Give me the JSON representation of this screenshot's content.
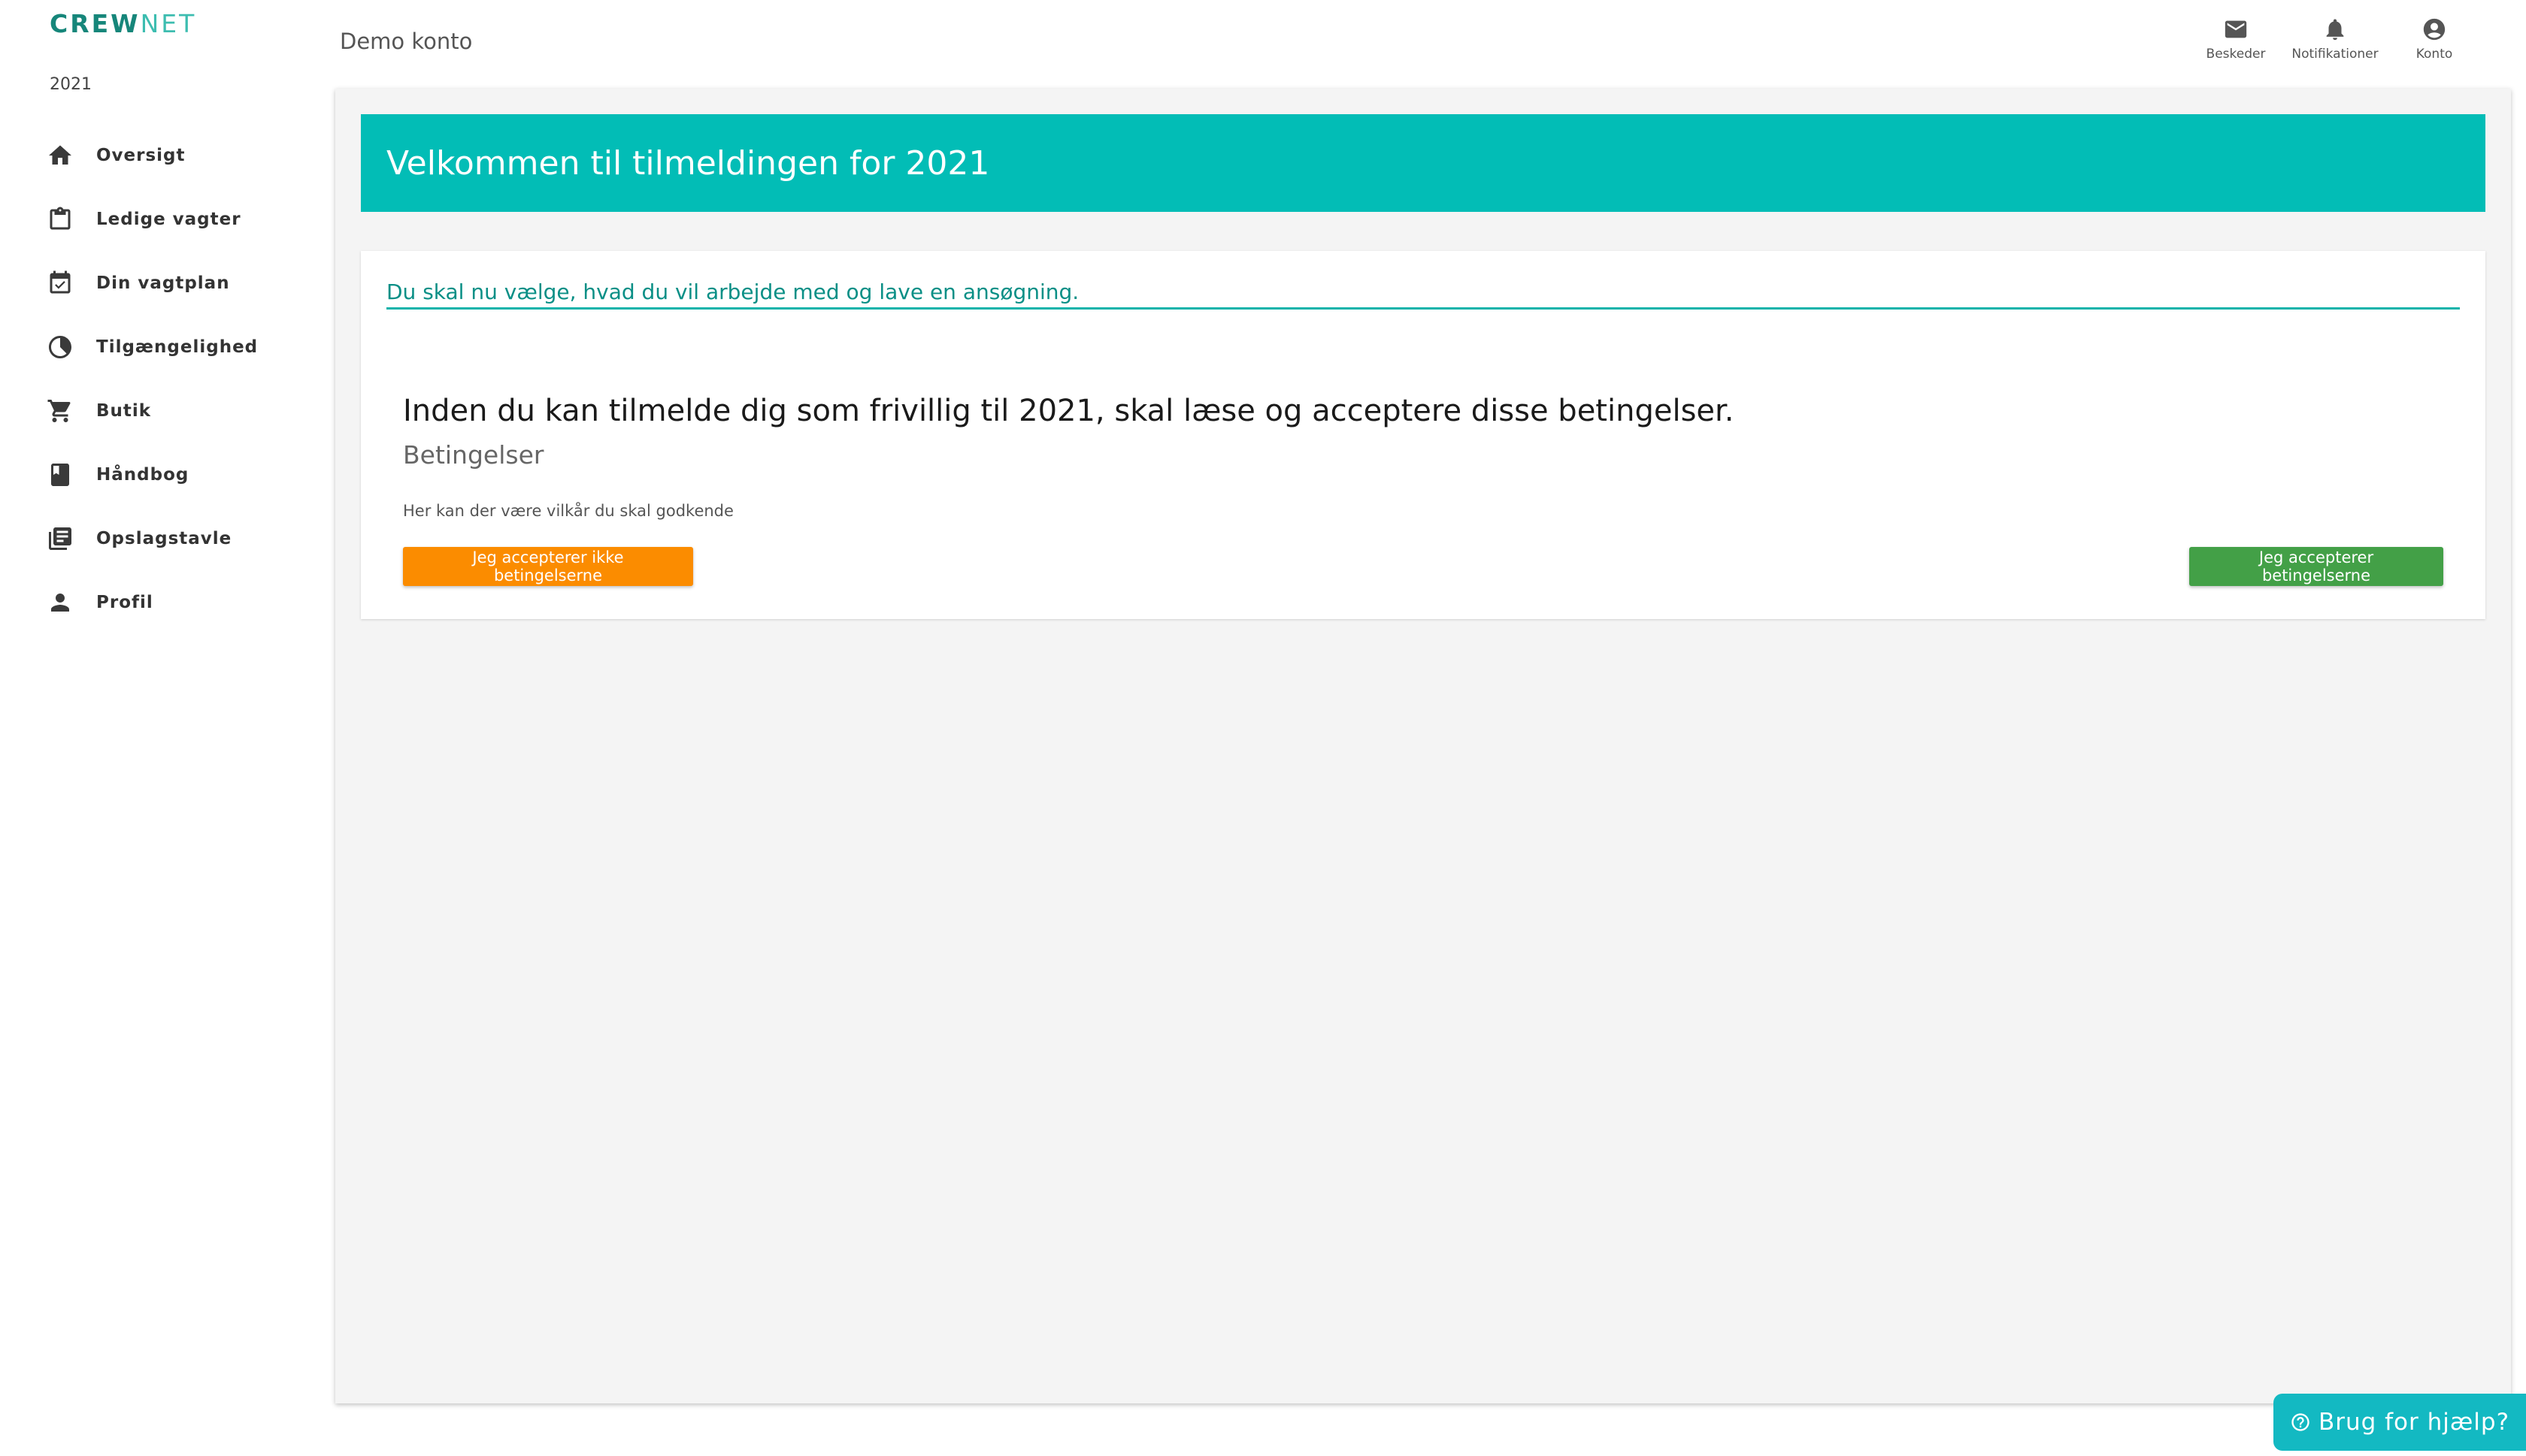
{
  "app": {
    "logo_part1": "CREW",
    "logo_part2": "NET",
    "year": "2021",
    "account_name": "Demo konto"
  },
  "sidebar": {
    "items": [
      {
        "label": "Oversigt",
        "icon": "home-icon"
      },
      {
        "label": "Ledige vagter",
        "icon": "clipboard-icon"
      },
      {
        "label": "Din vagtplan",
        "icon": "calendar-check-icon"
      },
      {
        "label": "Tilgængelighed",
        "icon": "availability-icon"
      },
      {
        "label": "Butik",
        "icon": "cart-icon"
      },
      {
        "label": "Håndbog",
        "icon": "book-icon"
      },
      {
        "label": "Opslagstavle",
        "icon": "bulletin-icon"
      },
      {
        "label": "Profil",
        "icon": "person-icon"
      }
    ]
  },
  "header": {
    "actions": [
      {
        "label": "Beskeder",
        "icon": "mail-icon"
      },
      {
        "label": "Notifikationer",
        "icon": "bell-icon"
      },
      {
        "label": "Konto",
        "icon": "account-circle-icon"
      }
    ]
  },
  "main": {
    "banner_title": "Velkommen til tilmeldingen for 2021",
    "instruction": "Du skal nu vælge, hvad du vil arbejde med og lave en ansøgning.",
    "terms_heading": "Inden du kan tilmelde dig som frivillig til 2021, skal læse og acceptere disse betingelser.",
    "terms_subheading": "Betingelser",
    "terms_text": "Her kan der være vilkår du skal godkende",
    "decline_label": "Jeg accepterer ikke betingelserne",
    "accept_label": "Jeg accepterer betingelserne"
  },
  "help": {
    "label": "Brug for hjælp?",
    "icon": "help-circle-icon"
  },
  "colors": {
    "brand_teal": "#02bdb6",
    "logo_dark": "#16867a",
    "decline": "#fb8c00",
    "accept": "#43a047",
    "help": "#13b9c2"
  }
}
